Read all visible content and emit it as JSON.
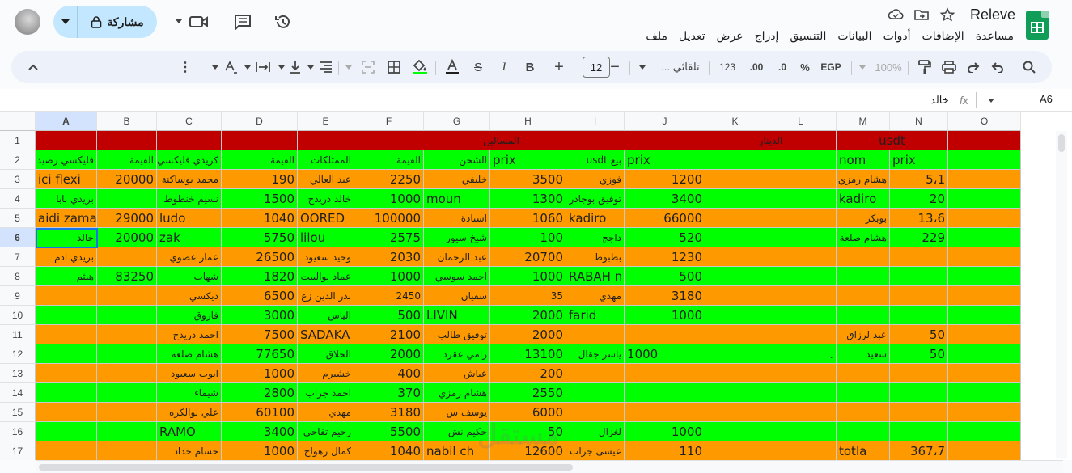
{
  "app": {
    "title": "Releve",
    "logo_icon": "google-sheets-logo-icon",
    "accent": "#0f9d58"
  },
  "menu": [
    "ملف",
    "تعديل",
    "عرض",
    "إدراج",
    "التنسيق",
    "البيانات",
    "أدوات",
    "الإضافات",
    "مساعدة"
  ],
  "share": {
    "label": "مشاركة",
    "bg": "#c2e7ff"
  },
  "toolbar": {
    "zoom": "100%",
    "currency": "EGP",
    "percent": "%",
    "dec_decrease": ".0",
    "dec_increase": ".00",
    "format_123": "123",
    "font_name": "تلقائي ...",
    "font_size": "12"
  },
  "formula_bar": {
    "cell_ref": "A6",
    "fx": "fx",
    "value": "خالد"
  },
  "sheet": {
    "columns": [
      "A",
      "B",
      "C",
      "D",
      "E",
      "F",
      "G",
      "H",
      "I",
      "J",
      "K",
      "L",
      "M",
      "N",
      "O"
    ],
    "rows": [
      "1",
      "2",
      "3",
      "4",
      "5",
      "6",
      "7",
      "8",
      "9",
      "10",
      "11",
      "12",
      "13",
      "14",
      "15",
      "16",
      "17"
    ],
    "colors": {
      "red": "#c00000",
      "green": "#00ff00",
      "orange": "#ff9900",
      "white": "#ffffff"
    },
    "row_fill": [
      "red",
      "green",
      "orange",
      "green",
      "orange",
      "green",
      "orange",
      "green",
      "orange",
      "green",
      "orange",
      "green",
      "orange",
      "green",
      "orange",
      "green",
      "orange"
    ],
    "merged_row1": [
      {
        "text": "المسالين",
        "from": "E",
        "to": "J"
      },
      {
        "text": "الدينار",
        "from": "K",
        "to": "L"
      },
      {
        "text": "usdt",
        "from": "M",
        "to": "N"
      }
    ],
    "cells": [
      {
        "r": 2,
        "c": "A",
        "v": "فليكسي رصيد",
        "ar": true
      },
      {
        "r": 2,
        "c": "B",
        "v": "القيمة",
        "ar": true
      },
      {
        "r": 2,
        "c": "C",
        "v": "كريدي فليكسي",
        "ar": true
      },
      {
        "r": 2,
        "c": "D",
        "v": "القيمة",
        "ar": true
      },
      {
        "r": 2,
        "c": "E",
        "v": "الممتلكات",
        "ar": true
      },
      {
        "r": 2,
        "c": "F",
        "v": "القيمة",
        "ar": true
      },
      {
        "r": 2,
        "c": "G",
        "v": "الشحن",
        "ar": true
      },
      {
        "r": 2,
        "c": "H",
        "v": "prix"
      },
      {
        "r": 2,
        "c": "I",
        "v": "بيع usdt",
        "ar": true
      },
      {
        "r": 2,
        "c": "J",
        "v": "prix"
      },
      {
        "r": 2,
        "c": "M",
        "v": "nom"
      },
      {
        "r": 2,
        "c": "N",
        "v": "prix"
      },
      {
        "r": 3,
        "c": "A",
        "v": "ici flexi"
      },
      {
        "r": 3,
        "c": "B",
        "v": "20000",
        "n": true
      },
      {
        "r": 3,
        "c": "C",
        "v": "محمد بوساكنة",
        "ar": true
      },
      {
        "r": 3,
        "c": "D",
        "v": "190",
        "n": true
      },
      {
        "r": 3,
        "c": "E",
        "v": "عبد العالي",
        "ar": true
      },
      {
        "r": 3,
        "c": "F",
        "v": "2250",
        "n": true
      },
      {
        "r": 3,
        "c": "G",
        "v": "خليفي",
        "ar": true
      },
      {
        "r": 3,
        "c": "H",
        "v": "3500",
        "n": true
      },
      {
        "r": 3,
        "c": "I",
        "v": "فوزي",
        "ar": true
      },
      {
        "r": 3,
        "c": "J",
        "v": "1200",
        "n": true
      },
      {
        "r": 3,
        "c": "M",
        "v": "هشام رمزي",
        "ar": true
      },
      {
        "r": 3,
        "c": "N",
        "v": "5،1",
        "n": true
      },
      {
        "r": 4,
        "c": "A",
        "v": "بريدي بابا",
        "ar": true
      },
      {
        "r": 4,
        "c": "C",
        "v": "نسيم خنطوط",
        "ar": true
      },
      {
        "r": 4,
        "c": "D",
        "v": "1500",
        "n": true
      },
      {
        "r": 4,
        "c": "E",
        "v": "خالد دريدح",
        "ar": true
      },
      {
        "r": 4,
        "c": "F",
        "v": "1000",
        "n": true
      },
      {
        "r": 4,
        "c": "G",
        "v": "moun"
      },
      {
        "r": 4,
        "c": "H",
        "v": "1300",
        "n": true
      },
      {
        "r": 4,
        "c": "I",
        "v": "توفيق بوجادر",
        "ar": true
      },
      {
        "r": 4,
        "c": "J",
        "v": "3400",
        "n": true
      },
      {
        "r": 4,
        "c": "M",
        "v": "kadiro"
      },
      {
        "r": 4,
        "c": "N",
        "v": "20",
        "n": true
      },
      {
        "r": 5,
        "c": "A",
        "v": "aidi zamar"
      },
      {
        "r": 5,
        "c": "B",
        "v": "29000",
        "n": true
      },
      {
        "r": 5,
        "c": "C",
        "v": "ludo"
      },
      {
        "r": 5,
        "c": "D",
        "v": "1040",
        "n": true
      },
      {
        "r": 5,
        "c": "E",
        "v": "OORED"
      },
      {
        "r": 5,
        "c": "F",
        "v": "100000",
        "n": true
      },
      {
        "r": 5,
        "c": "G",
        "v": "استادة",
        "ar": true
      },
      {
        "r": 5,
        "c": "H",
        "v": "1060",
        "n": true
      },
      {
        "r": 5,
        "c": "I",
        "v": "kadiro"
      },
      {
        "r": 5,
        "c": "J",
        "v": "66000",
        "n": true
      },
      {
        "r": 5,
        "c": "M",
        "v": "بوبكر",
        "ar": true
      },
      {
        "r": 5,
        "c": "N",
        "v": "13،6",
        "n": true
      },
      {
        "r": 6,
        "c": "A",
        "v": "خالد",
        "ar": true
      },
      {
        "r": 6,
        "c": "B",
        "v": "20000",
        "n": true
      },
      {
        "r": 6,
        "c": "C",
        "v": "zak"
      },
      {
        "r": 6,
        "c": "D",
        "v": "5750",
        "n": true
      },
      {
        "r": 6,
        "c": "E",
        "v": "lilou"
      },
      {
        "r": 6,
        "c": "F",
        "v": "2575",
        "n": true
      },
      {
        "r": 6,
        "c": "G",
        "v": "شيخ سيور",
        "ar": true
      },
      {
        "r": 6,
        "c": "H",
        "v": "100",
        "n": true
      },
      {
        "r": 6,
        "c": "I",
        "v": "داجج",
        "ar": true
      },
      {
        "r": 6,
        "c": "J",
        "v": "520",
        "n": true
      },
      {
        "r": 6,
        "c": "M",
        "v": "هشام صلعة",
        "ar": true
      },
      {
        "r": 6,
        "c": "N",
        "v": "229",
        "n": true
      },
      {
        "r": 7,
        "c": "A",
        "v": "بريدي ادم",
        "ar": true
      },
      {
        "r": 7,
        "c": "C",
        "v": "عمار عصوي",
        "ar": true
      },
      {
        "r": 7,
        "c": "D",
        "v": "26500",
        "n": true
      },
      {
        "r": 7,
        "c": "E",
        "v": "وحيد سعيود",
        "ar": true
      },
      {
        "r": 7,
        "c": "F",
        "v": "2030",
        "n": true
      },
      {
        "r": 7,
        "c": "G",
        "v": "عبد الرحمان",
        "ar": true
      },
      {
        "r": 7,
        "c": "H",
        "v": "20700",
        "n": true
      },
      {
        "r": 7,
        "c": "I",
        "v": "بطبوط",
        "ar": true
      },
      {
        "r": 7,
        "c": "J",
        "v": "1230",
        "n": true
      },
      {
        "r": 8,
        "c": "A",
        "v": "هيثم",
        "ar": true
      },
      {
        "r": 8,
        "c": "B",
        "v": "83250",
        "n": true
      },
      {
        "r": 8,
        "c": "C",
        "v": "شهاب",
        "ar": true
      },
      {
        "r": 8,
        "c": "D",
        "v": "1820",
        "n": true
      },
      {
        "r": 8,
        "c": "E",
        "v": "عماد بوالبيت",
        "ar": true
      },
      {
        "r": 8,
        "c": "F",
        "v": "1000",
        "n": true
      },
      {
        "r": 8,
        "c": "G",
        "v": "احمد سوسي",
        "ar": true
      },
      {
        "r": 8,
        "c": "H",
        "v": "1000",
        "n": true
      },
      {
        "r": 8,
        "c": "I",
        "v": "RABAH n"
      },
      {
        "r": 8,
        "c": "J",
        "v": "500",
        "n": true
      },
      {
        "r": 9,
        "c": "C",
        "v": "ديكسي",
        "ar": true
      },
      {
        "r": 9,
        "c": "D",
        "v": "6500",
        "n": true
      },
      {
        "r": 9,
        "c": "E",
        "v": "بدر الدين زع",
        "ar": true
      },
      {
        "r": 9,
        "c": "F",
        "v": "2450",
        "n": true,
        "sm": true
      },
      {
        "r": 9,
        "c": "G",
        "v": "سفيان",
        "ar": true
      },
      {
        "r": 9,
        "c": "H",
        "v": "35",
        "n": true,
        "sm": true
      },
      {
        "r": 9,
        "c": "I",
        "v": "مهدي",
        "ar": true
      },
      {
        "r": 9,
        "c": "J",
        "v": "3180",
        "n": true
      },
      {
        "r": 10,
        "c": "C",
        "v": "فاروق",
        "ar": true
      },
      {
        "r": 10,
        "c": "D",
        "v": "3000",
        "n": true
      },
      {
        "r": 10,
        "c": "E",
        "v": "الياس",
        "ar": true
      },
      {
        "r": 10,
        "c": "F",
        "v": "500",
        "n": true
      },
      {
        "r": 10,
        "c": "G",
        "v": "LIVIN"
      },
      {
        "r": 10,
        "c": "H",
        "v": "2000",
        "n": true
      },
      {
        "r": 10,
        "c": "I",
        "v": "farid"
      },
      {
        "r": 10,
        "c": "J",
        "v": "1000",
        "n": true
      },
      {
        "r": 11,
        "c": "C",
        "v": "احمد دريدح",
        "ar": true
      },
      {
        "r": 11,
        "c": "D",
        "v": "7500",
        "n": true
      },
      {
        "r": 11,
        "c": "E",
        "v": "SADAKA"
      },
      {
        "r": 11,
        "c": "F",
        "v": "2100",
        "n": true
      },
      {
        "r": 11,
        "c": "G",
        "v": "توفيق طالب",
        "ar": true
      },
      {
        "r": 11,
        "c": "H",
        "v": "2000",
        "n": true
      },
      {
        "r": 11,
        "c": "M",
        "v": "عبد لرزاق",
        "ar": true
      },
      {
        "r": 11,
        "c": "N",
        "v": "50",
        "n": true
      },
      {
        "r": 12,
        "c": "C",
        "v": "هشام صلعة",
        "ar": true
      },
      {
        "r": 12,
        "c": "D",
        "v": "77650",
        "n": true
      },
      {
        "r": 12,
        "c": "E",
        "v": "الحلاق",
        "ar": true
      },
      {
        "r": 12,
        "c": "F",
        "v": "2000",
        "n": true
      },
      {
        "r": 12,
        "c": "G",
        "v": "رامي عقرد",
        "ar": true
      },
      {
        "r": 12,
        "c": "H",
        "v": "13100",
        "n": true
      },
      {
        "r": 12,
        "c": "I",
        "v": "ياسر جقال",
        "ar": true
      },
      {
        "r": 12,
        "c": "J",
        "v": "1000"
      },
      {
        "r": 12,
        "c": "L",
        "v": ".",
        "n": true
      },
      {
        "r": 12,
        "c": "M",
        "v": "سعيد",
        "ar": true
      },
      {
        "r": 12,
        "c": "N",
        "v": "50",
        "n": true
      },
      {
        "r": 13,
        "c": "C",
        "v": "ايوب سعيود",
        "ar": true
      },
      {
        "r": 13,
        "c": "D",
        "v": "1000",
        "n": true
      },
      {
        "r": 13,
        "c": "E",
        "v": "خشيرم",
        "ar": true
      },
      {
        "r": 13,
        "c": "F",
        "v": "400",
        "n": true
      },
      {
        "r": 13,
        "c": "G",
        "v": "عياش",
        "ar": true
      },
      {
        "r": 13,
        "c": "H",
        "v": "200",
        "n": true
      },
      {
        "r": 14,
        "c": "C",
        "v": "شيماء",
        "ar": true
      },
      {
        "r": 14,
        "c": "D",
        "v": "2800",
        "n": true
      },
      {
        "r": 14,
        "c": "E",
        "v": "احمد جراب",
        "ar": true
      },
      {
        "r": 14,
        "c": "F",
        "v": "370",
        "n": true
      },
      {
        "r": 14,
        "c": "G",
        "v": "هشام رمزي",
        "ar": true
      },
      {
        "r": 14,
        "c": "H",
        "v": "2550",
        "n": true
      },
      {
        "r": 15,
        "c": "C",
        "v": "علي بوالكره",
        "ar": true
      },
      {
        "r": 15,
        "c": "D",
        "v": "60100",
        "n": true
      },
      {
        "r": 15,
        "c": "E",
        "v": "مهدي",
        "ar": true
      },
      {
        "r": 15,
        "c": "F",
        "v": "3180",
        "n": true
      },
      {
        "r": 15,
        "c": "G",
        "v": "يوسف س",
        "ar": true
      },
      {
        "r": 15,
        "c": "H",
        "v": "6000",
        "n": true
      },
      {
        "r": 16,
        "c": "C",
        "v": "RAMO"
      },
      {
        "r": 16,
        "c": "D",
        "v": "3400",
        "n": true
      },
      {
        "r": 16,
        "c": "E",
        "v": "رحيم تفاحي",
        "ar": true
      },
      {
        "r": 16,
        "c": "F",
        "v": "5500",
        "n": true
      },
      {
        "r": 16,
        "c": "G",
        "v": "حكيم نش",
        "ar": true
      },
      {
        "r": 16,
        "c": "H",
        "v": "50",
        "n": true
      },
      {
        "r": 16,
        "c": "I",
        "v": "لغزال",
        "ar": true
      },
      {
        "r": 16,
        "c": "J",
        "v": "1000",
        "n": true
      },
      {
        "r": 17,
        "c": "C",
        "v": "حسام حداد",
        "ar": true
      },
      {
        "r": 17,
        "c": "D",
        "v": "1000",
        "n": true
      },
      {
        "r": 17,
        "c": "E",
        "v": "كمال رهواج",
        "ar": true
      },
      {
        "r": 17,
        "c": "F",
        "v": "1040",
        "n": true
      },
      {
        "r": 17,
        "c": "G",
        "v": "nabil ch"
      },
      {
        "r": 17,
        "c": "H",
        "v": "12600",
        "n": true
      },
      {
        "r": 17,
        "c": "I",
        "v": "عيسى جراب",
        "ar": true
      },
      {
        "r": 17,
        "c": "J",
        "v": "110",
        "n": true
      },
      {
        "r": 17,
        "c": "M",
        "v": "totla"
      },
      {
        "r": 17,
        "c": "N",
        "v": "367،7",
        "n": true
      }
    ],
    "selected": "A6"
  },
  "watermark": "مستقل"
}
